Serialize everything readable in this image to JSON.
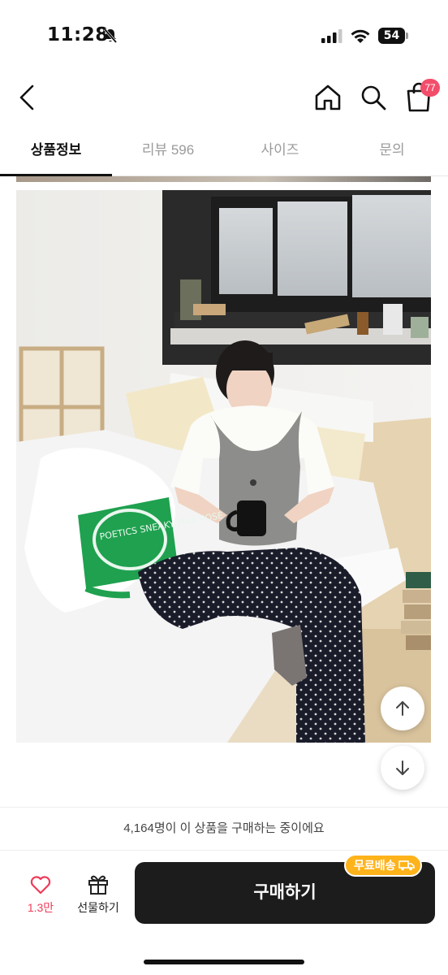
{
  "status_bar": {
    "time": "11:28",
    "battery": "54"
  },
  "header": {
    "cart_count": "77"
  },
  "tabs": [
    {
      "label": "상품정보",
      "active": true
    },
    {
      "label": "리뷰 596",
      "active": false
    },
    {
      "label": "사이즈",
      "active": false
    },
    {
      "label": "문의",
      "active": false
    }
  ],
  "content": {
    "bag_text": "POETICS SNEAKY MAX POSE"
  },
  "purchase_info": "4,164명이 이 상품을 구매하는 중이에요",
  "bottom_bar": {
    "like_count": "1.3만",
    "gift_label": "선물하기",
    "buy_label": "구매하기",
    "free_shipping": "무료배송"
  },
  "colors": {
    "accent": "#1c1c1c",
    "badge": "#f24e6b",
    "like": "#ef3b5a",
    "shipping": "#ffb31a"
  }
}
